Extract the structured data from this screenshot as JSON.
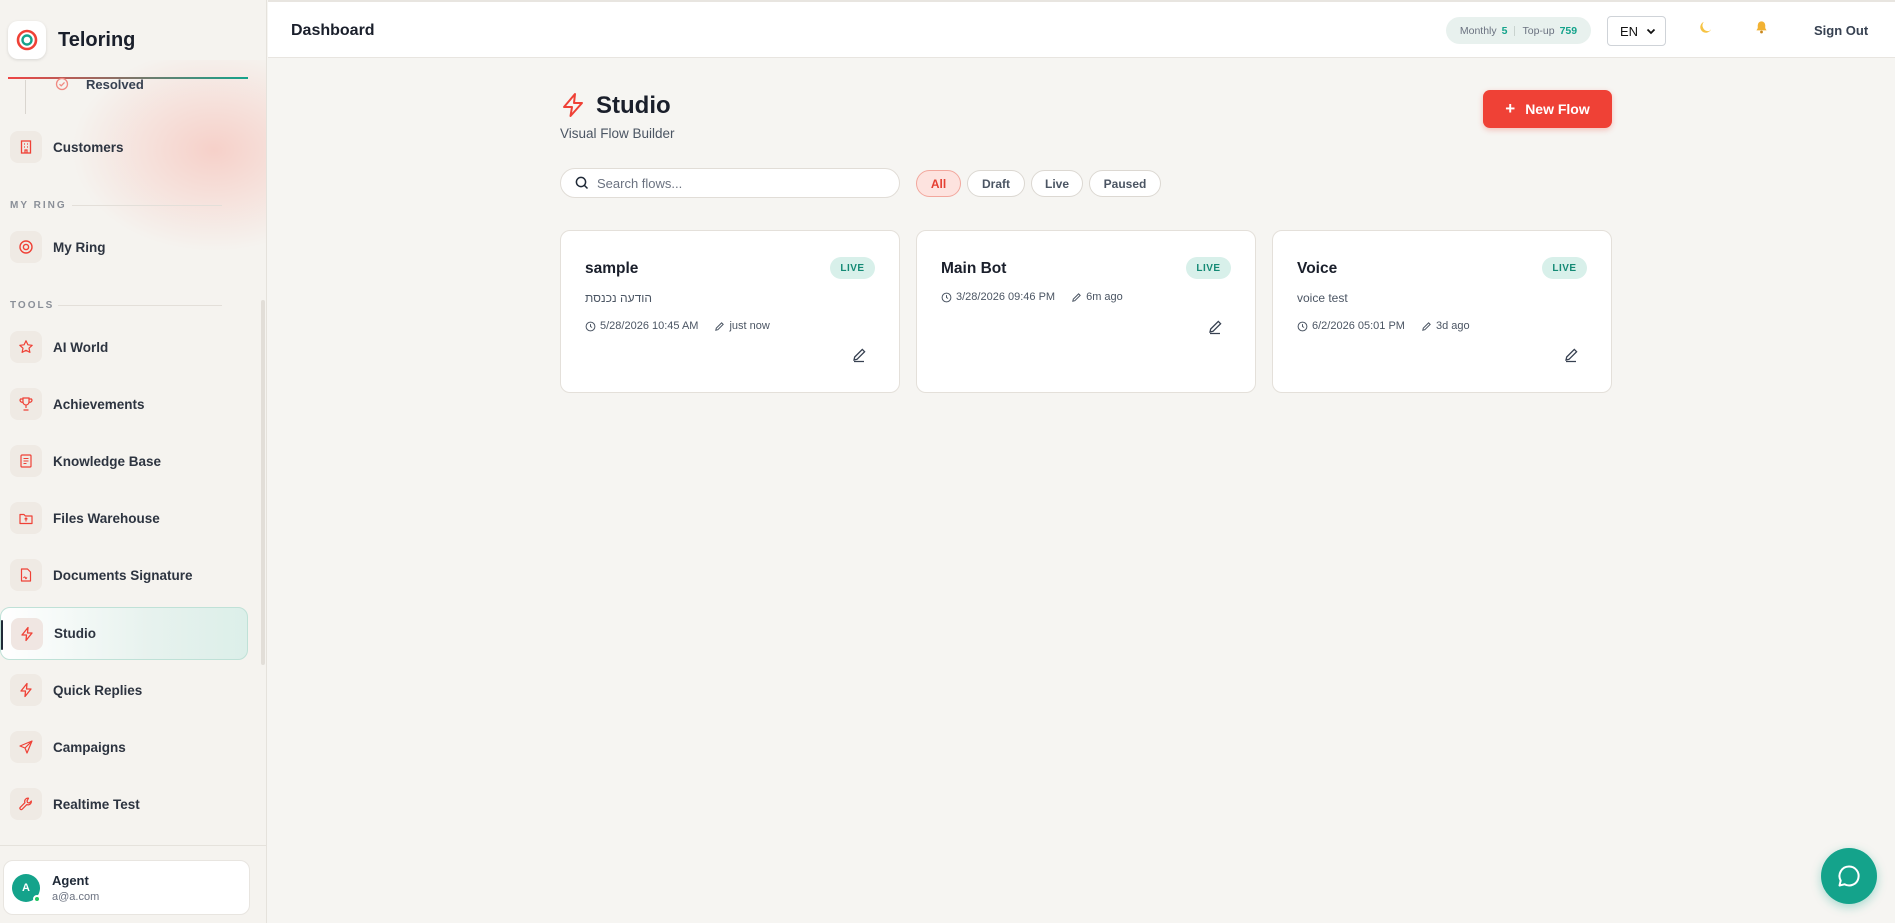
{
  "app": {
    "name": "Teloring"
  },
  "sidebar": {
    "sub_item": {
      "label": "Resolved"
    },
    "items_top": [
      {
        "label": "Customers"
      }
    ],
    "section_my_ring": "MY RING",
    "my_ring": {
      "label": "My Ring"
    },
    "section_tools": "TOOLS",
    "tools": [
      {
        "label": "AI World"
      },
      {
        "label": "Achievements"
      },
      {
        "label": "Knowledge Base"
      },
      {
        "label": "Files Warehouse"
      },
      {
        "label": "Documents Signature"
      },
      {
        "label": "Studio"
      },
      {
        "label": "Quick Replies"
      },
      {
        "label": "Campaigns"
      },
      {
        "label": "Realtime Test"
      }
    ],
    "user": {
      "initial": "A",
      "name": "Agent",
      "email": "a@a.com"
    }
  },
  "topbar": {
    "title": "Dashboard",
    "credits": {
      "monthly_label": "Monthly",
      "monthly_value": "5",
      "topup_label": "Top-up",
      "topup_value": "759"
    },
    "language": "EN",
    "signout": "Sign Out"
  },
  "studio": {
    "title": "Studio",
    "subtitle": "Visual Flow Builder",
    "new_flow_label": "New Flow",
    "search_placeholder": "Search flows...",
    "filters": [
      "All",
      "Draft",
      "Live",
      "Paused"
    ],
    "active_filter": "All",
    "flows": [
      {
        "name": "sample",
        "status": "LIVE",
        "description": "הודעה נכנסת",
        "created": "5/28/2026 10:45 AM",
        "edited": "just now"
      },
      {
        "name": "Main Bot",
        "status": "LIVE",
        "description": "",
        "created": "3/28/2026 09:46 PM",
        "edited": "6m ago"
      },
      {
        "name": "Voice",
        "status": "LIVE",
        "description": "voice test",
        "created": "6/2/2026 05:01 PM",
        "edited": "3d ago"
      }
    ]
  },
  "colors": {
    "accent": "#ef4136",
    "teal": "#14a38b",
    "badge_bg": "#d8f0ea"
  }
}
